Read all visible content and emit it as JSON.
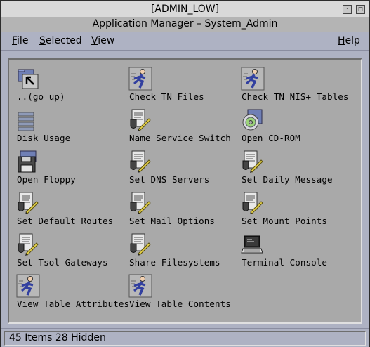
{
  "label_bar": {
    "text": "[ADMIN_LOW]"
  },
  "window": {
    "title": "Application Manager – System_Admin"
  },
  "menu": {
    "file": {
      "first": "F",
      "rest": "ile"
    },
    "selected": {
      "first": "S",
      "rest": "elected"
    },
    "view": {
      "first": "V",
      "rest": "iew"
    },
    "help": {
      "first": "H",
      "rest": "elp"
    }
  },
  "items": [
    {
      "label": "..(go up)",
      "icon": "go-up-folder-icon"
    },
    {
      "label": "Check TN Files",
      "icon": "runner-icon"
    },
    {
      "label": "Check TN NIS+ Tables",
      "icon": "runner-icon"
    },
    {
      "label": "Disk Usage",
      "icon": "disk-usage-icon"
    },
    {
      "label": "Name Service Switch",
      "icon": "document-shield-icon"
    },
    {
      "label": "Open CD-ROM",
      "icon": "cdrom-icon"
    },
    {
      "label": "Open Floppy",
      "icon": "floppy-icon"
    },
    {
      "label": "Set DNS Servers",
      "icon": "document-shield-icon"
    },
    {
      "label": "Set Daily Message",
      "icon": "document-shield-icon"
    },
    {
      "label": "Set Default Routes",
      "icon": "document-shield-icon"
    },
    {
      "label": "Set Mail Options",
      "icon": "document-shield-icon"
    },
    {
      "label": "Set Mount Points",
      "icon": "document-shield-icon"
    },
    {
      "label": "Set Tsol Gateways",
      "icon": "document-shield-icon"
    },
    {
      "label": "Share Filesystems",
      "icon": "document-shield-icon"
    },
    {
      "label": "Terminal Console",
      "icon": "terminal-icon"
    },
    {
      "label": "View Table Attributes",
      "icon": "runner-icon"
    },
    {
      "label": "View Table Contents",
      "icon": "runner-icon"
    }
  ],
  "status": {
    "text": "45 Items 28 Hidden"
  }
}
